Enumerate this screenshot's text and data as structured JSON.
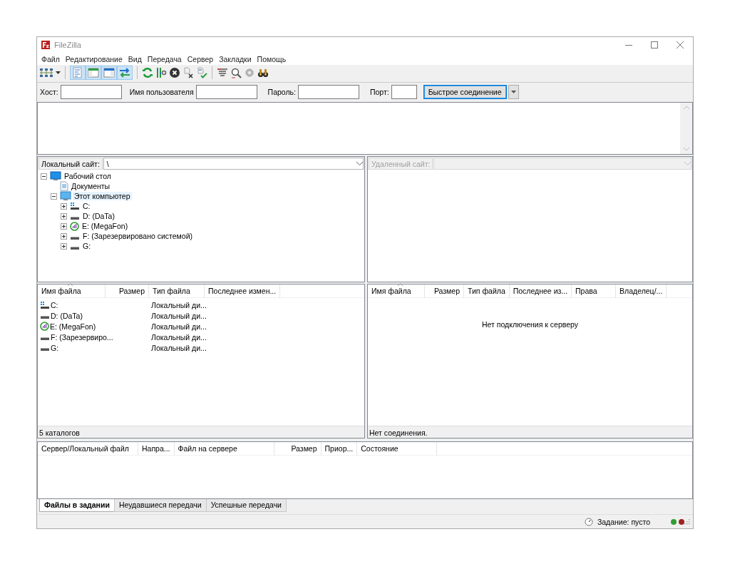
{
  "window": {
    "title": "FileZilla"
  },
  "menu": [
    "Файл",
    "Редактирование",
    "Вид",
    "Передача",
    "Сервер",
    "Закладки",
    "Помощь"
  ],
  "toolbar": {
    "toggles": [
      {
        "selected": true
      },
      {
        "selected": true
      },
      {
        "selected": true
      },
      {
        "selected": true
      }
    ]
  },
  "quickconnect": {
    "fields": [
      {
        "label": "Хост:"
      },
      {
        "label": "Имя пользователя"
      },
      {
        "label": "Пароль:"
      },
      {
        "label": "Порт:"
      }
    ],
    "button": "Быстрое соединение"
  },
  "local_site": {
    "label": "Локальный сайт:",
    "path": "\\",
    "tree": [
      {
        "label": "Рабочий стол",
        "kind": "desktop",
        "expanded": true,
        "selected": false,
        "children": [
          {
            "label": "Документы",
            "kind": "document",
            "selected": false
          },
          {
            "label": "Этот компьютер",
            "kind": "computer",
            "expanded": true,
            "selected": true,
            "children": [
              {
                "label": "C:",
                "kind": "system-drive",
                "expanded": false,
                "selected": false
              },
              {
                "label": "D: (DaTa)",
                "kind": "drive",
                "expanded": false,
                "selected": false
              },
              {
                "label": "E: (MegaFon)",
                "kind": "modem",
                "expanded": false,
                "selected": false
              },
              {
                "label": "F: (Зарезервировано системой)",
                "kind": "drive",
                "expanded": false,
                "selected": false
              },
              {
                "label": "G:",
                "kind": "drive",
                "expanded": false,
                "selected": false
              }
            ]
          }
        ]
      }
    ]
  },
  "remote_site": {
    "label": "Удаленный сайт:",
    "disabled": true
  },
  "local_files": {
    "columns": [
      "Имя файла",
      "Размер",
      "Тип файла",
      "Последнее измен..."
    ],
    "rows": [
      {
        "name": "C:",
        "kind": "system-drive",
        "type": "Локальный ди..."
      },
      {
        "name": "D: (DaTa)",
        "kind": "drive",
        "type": "Локальный ди..."
      },
      {
        "name": "E: (MegaFon)",
        "kind": "modem",
        "type": "Локальный ди..."
      },
      {
        "name": "F: (Зарезервиро...",
        "kind": "drive",
        "type": "Локальный ди..."
      },
      {
        "name": "G:",
        "kind": "drive",
        "type": "Локальный ди..."
      }
    ],
    "status": "5 каталогов"
  },
  "remote_files": {
    "columns": [
      "Имя файла",
      "Размер",
      "Тип файла",
      "Последнее из...",
      "Права",
      "Владелец/..."
    ],
    "message": "Нет подключения к серверу",
    "status": "Нет соединения."
  },
  "queue": {
    "columns": [
      "Сервер/Локальный файл",
      "Напра...",
      "Файл на сервере",
      "Размер",
      "Приор...",
      "Состояние"
    ],
    "tabs": [
      {
        "label": "Файлы в задании",
        "selected": true
      },
      {
        "label": "Неудавшиеся передачи",
        "selected": false
      },
      {
        "label": "Успешные передачи",
        "selected": false
      }
    ]
  },
  "status_bar": {
    "queue_status": "Задание: пусто",
    "indicators": [
      {
        "color": "#2f9e2f"
      },
      {
        "color": "#a02222"
      }
    ]
  }
}
